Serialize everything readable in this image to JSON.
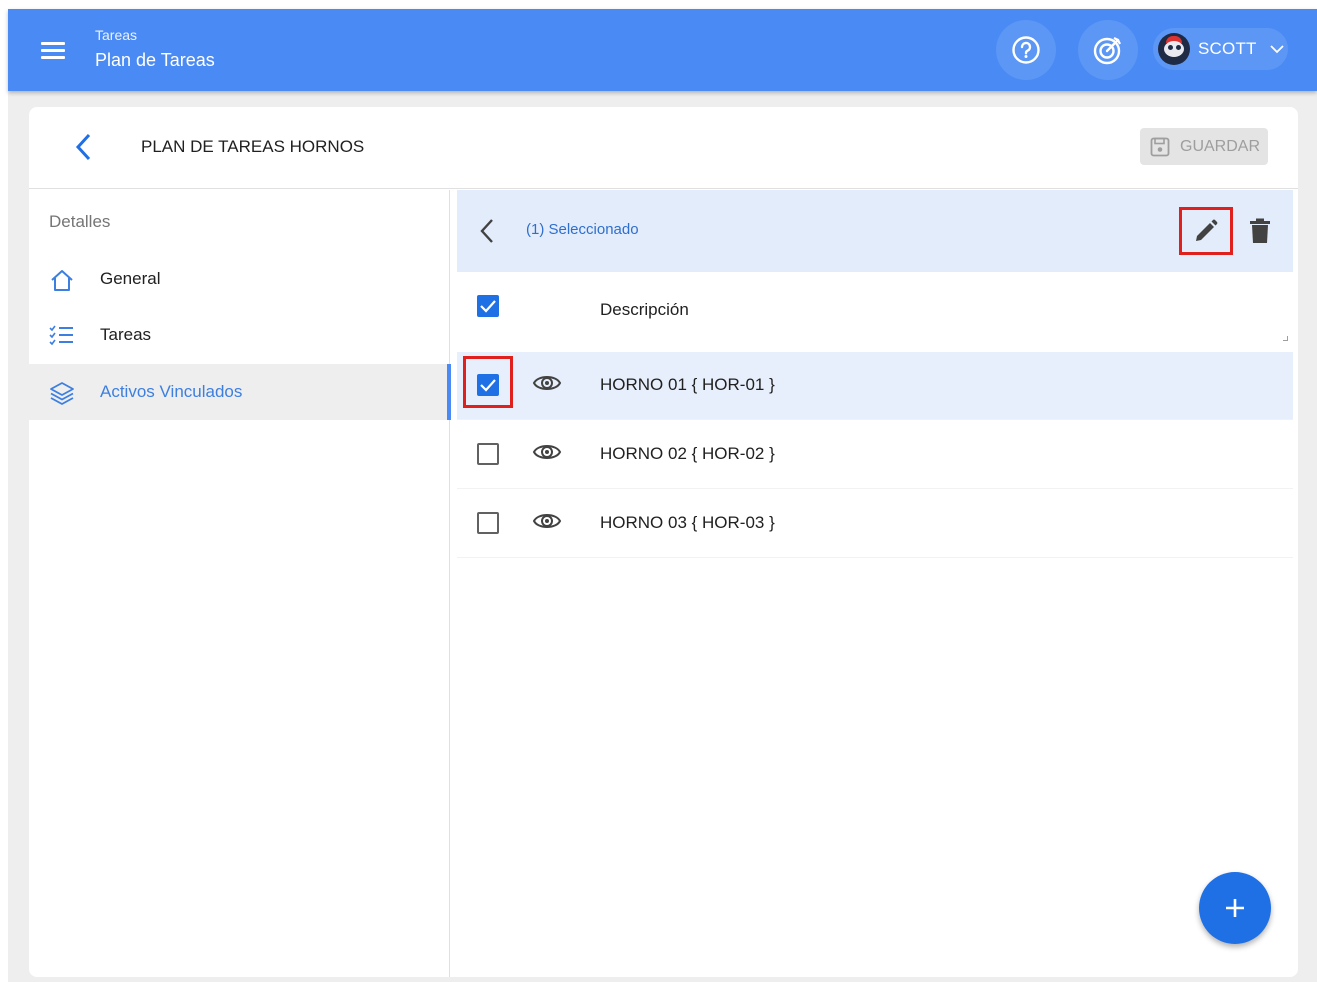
{
  "appbar": {
    "breadcrumb": "Tareas",
    "title": "Plan de Tareas",
    "user_name": "SCOTT",
    "icons": [
      "menu-icon",
      "help-icon",
      "target-icon",
      "avatar",
      "chevron-down-icon"
    ]
  },
  "card": {
    "title": "PLAN DE TAREAS HORNOS",
    "save_label": "GUARDAR"
  },
  "sidebar": {
    "heading": "Detalles",
    "items": [
      {
        "label": "General",
        "icon": "home-icon",
        "active": false
      },
      {
        "label": "Tareas",
        "icon": "checklist-icon",
        "active": false
      },
      {
        "label": "Activos Vinculados",
        "icon": "layers-icon",
        "active": true
      }
    ]
  },
  "panel": {
    "selection_text": "(1) Seleccionado",
    "column_header": "Descripción",
    "rows": [
      {
        "description": "HORNO 01 { HOR-01 }",
        "checked": true
      },
      {
        "description": "HORNO 02 { HOR-02 }",
        "checked": false
      },
      {
        "description": "HORNO 03 { HOR-03 }",
        "checked": false
      }
    ]
  },
  "colors": {
    "appbar": "#4a8af4",
    "accent": "#1f6fe5",
    "highlight": "#e0201c",
    "selection_bg": "#e3ecfb"
  }
}
